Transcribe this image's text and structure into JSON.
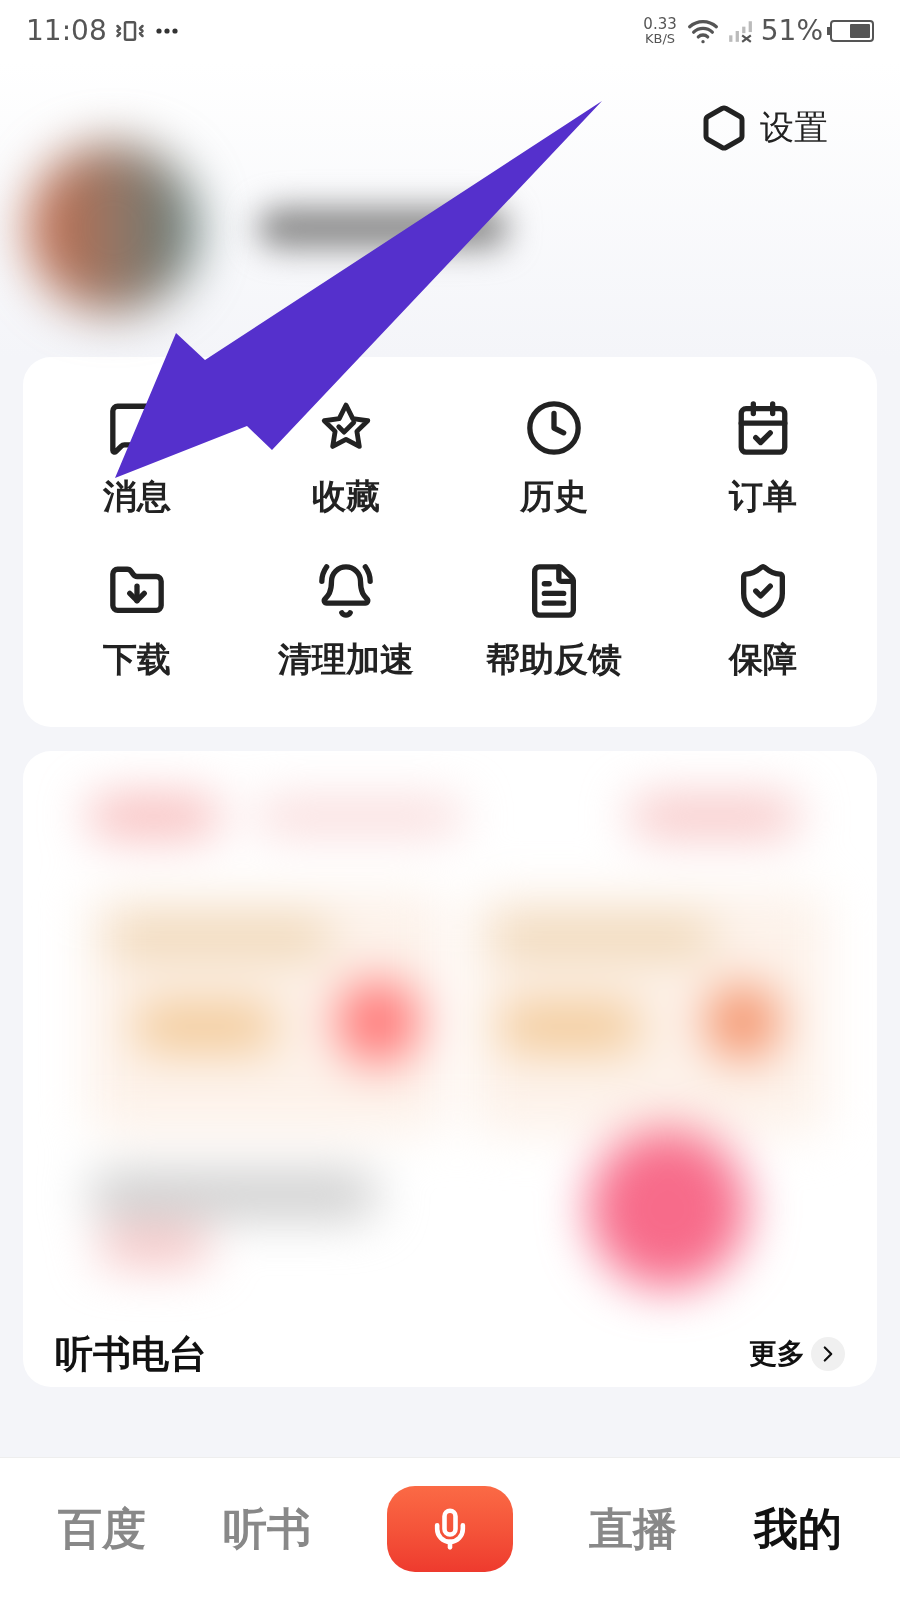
{
  "status_bar": {
    "time": "11:08",
    "speed": "0.33",
    "speed_unit": "KB/S",
    "battery": "51%"
  },
  "settings": {
    "label": "设置"
  },
  "shortcuts": [
    {
      "label": "消息"
    },
    {
      "label": "收藏"
    },
    {
      "label": "历史"
    },
    {
      "label": "订单"
    },
    {
      "label": "下载"
    },
    {
      "label": "清理加速"
    },
    {
      "label": "帮助反馈"
    },
    {
      "label": "保障"
    }
  ],
  "section": {
    "title": "听书电台",
    "more": "更多"
  },
  "bottom_nav": [
    {
      "kind": "text",
      "label": "百度",
      "selected": false
    },
    {
      "kind": "text",
      "label": "听书",
      "selected": false
    },
    {
      "kind": "mic",
      "selected": false
    },
    {
      "kind": "text",
      "label": "直播",
      "selected": false
    },
    {
      "kind": "text",
      "label": "我的",
      "selected": true
    }
  ]
}
